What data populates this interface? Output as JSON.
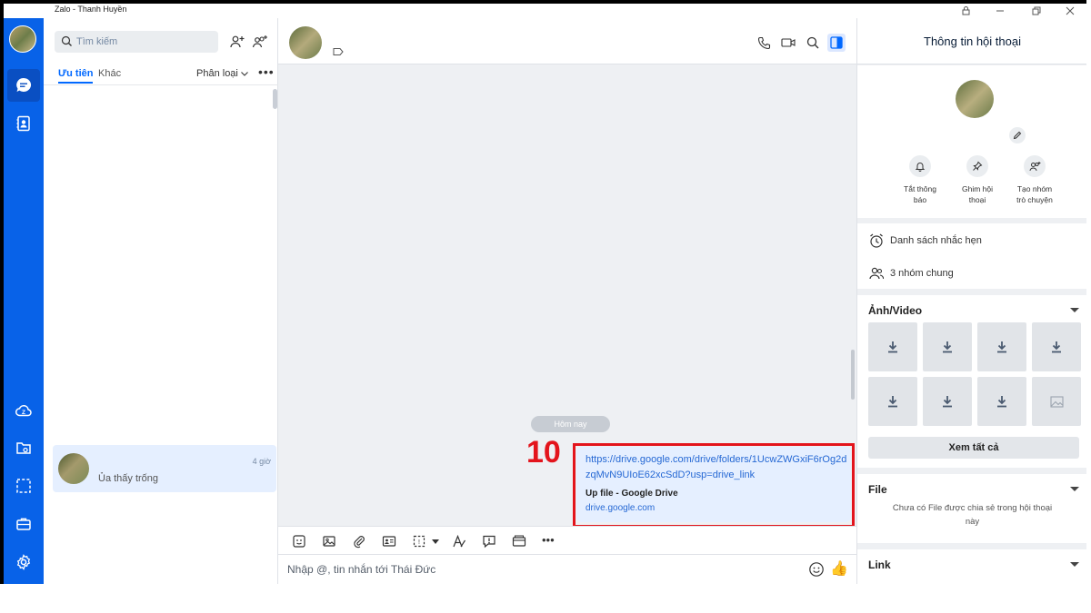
{
  "window": {
    "title": "Zalo - Thanh Huyền"
  },
  "sidebar": {
    "search_placeholder": "Tìm kiếm",
    "tabs": [
      "Ưu tiên",
      "Khác"
    ],
    "filter_label": "Phân loại",
    "conversations": [
      {
        "time": "4 giờ",
        "last_message": "Ủa thấy trống"
      }
    ]
  },
  "chat": {
    "date_separator": "Hôm nay",
    "step_label": "10",
    "message": {
      "link": "https://drive.google.com/drive/folders/1UcwZWGxiF6rOg2dzqMvN9UIoE62xcSdD?usp=drive_link",
      "preview_title": "Up file - Google Drive",
      "preview_domain": "drive.google.com"
    },
    "composer_placeholder": "Nhập @, tin nhắn tới Thái Đức"
  },
  "info_panel": {
    "title": "Thông tin hội thoại",
    "actions": [
      {
        "label": "Tắt thông báo",
        "icon": "bell-icon"
      },
      {
        "label": "Ghim hội thoại",
        "icon": "pin-icon"
      },
      {
        "label": "Tạo nhóm trò chuyện",
        "icon": "add-group-icon"
      }
    ],
    "reminders_label": "Danh sách nhắc hẹn",
    "groups_label": "3 nhóm chung",
    "media_title": "Ảnh/Video",
    "see_all_label": "Xem tất cả",
    "file_title": "File",
    "file_empty_text": "Chưa có File được chia sẻ trong hội thoại này",
    "link_title": "Link"
  },
  "colors": {
    "nav_blue": "#0862e8",
    "link_blue": "#2568d4",
    "highlight_red": "#e3141c",
    "bubble_bg": "#e5efff"
  }
}
